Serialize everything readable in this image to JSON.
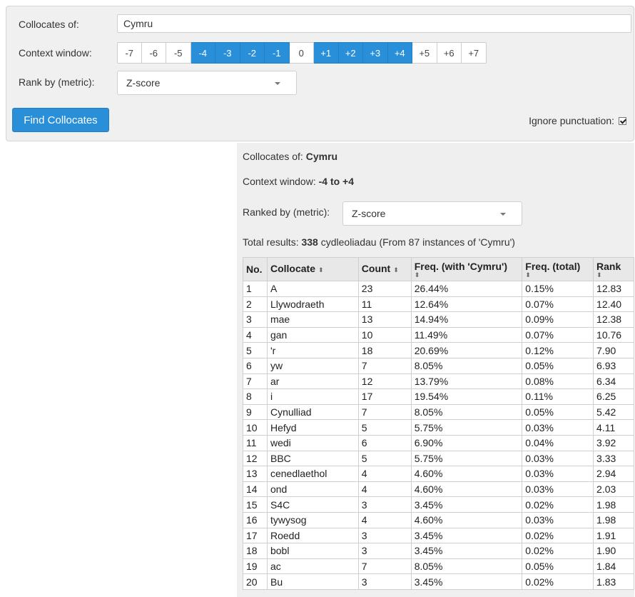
{
  "form": {
    "collocates_label": "Collocates of:",
    "collocates_value": "Cymru",
    "context_label": "Context window:",
    "context_cells": [
      {
        "label": "-7",
        "selected": false
      },
      {
        "label": "-6",
        "selected": false
      },
      {
        "label": "-5",
        "selected": false
      },
      {
        "label": "-4",
        "selected": true
      },
      {
        "label": "-3",
        "selected": true
      },
      {
        "label": "-2",
        "selected": true
      },
      {
        "label": "-1",
        "selected": true
      },
      {
        "label": "0",
        "selected": false
      },
      {
        "label": "+1",
        "selected": true
      },
      {
        "label": "+2",
        "selected": true
      },
      {
        "label": "+3",
        "selected": true
      },
      {
        "label": "+4",
        "selected": true
      },
      {
        "label": "+5",
        "selected": false
      },
      {
        "label": "+6",
        "selected": false
      },
      {
        "label": "+7",
        "selected": false
      }
    ],
    "rank_label": "Rank by (metric):",
    "rank_value": "Z-score",
    "find_button": "Find Collocates",
    "ignore_label": "Ignore punctuation:",
    "ignore_checked": true,
    "accent_color": "#2a8fd9"
  },
  "results": {
    "collocates_of_prefix": "Collocates of: ",
    "collocates_of_word": "Cymru",
    "context_prefix": "Context window: ",
    "context_range": "-4 to +4",
    "ranked_label": "Ranked by (metric):",
    "ranked_value": "Z-score",
    "total_prefix": "Total results: ",
    "total_count": "338",
    "total_suffix": " cydleoliadau (From 87 instances of 'Cymru')",
    "columns": [
      "No.",
      "Collocate",
      "Count",
      "Freq. (with 'Cymru')",
      "Freq. (total)",
      "Rank"
    ],
    "rows": [
      [
        "1",
        "A",
        "23",
        "26.44%",
        "0.15%",
        "12.83"
      ],
      [
        "2",
        "Llywodraeth",
        "11",
        "12.64%",
        "0.07%",
        "12.40"
      ],
      [
        "3",
        "mae",
        "13",
        "14.94%",
        "0.09%",
        "12.38"
      ],
      [
        "4",
        "gan",
        "10",
        "11.49%",
        "0.07%",
        "10.76"
      ],
      [
        "5",
        "'r",
        "18",
        "20.69%",
        "0.12%",
        "7.90"
      ],
      [
        "6",
        "yw",
        "7",
        "8.05%",
        "0.05%",
        "6.93"
      ],
      [
        "7",
        "ar",
        "12",
        "13.79%",
        "0.08%",
        "6.34"
      ],
      [
        "8",
        "i",
        "17",
        "19.54%",
        "0.11%",
        "6.25"
      ],
      [
        "9",
        "Cynulliad",
        "7",
        "8.05%",
        "0.05%",
        "5.42"
      ],
      [
        "10",
        "Hefyd",
        "5",
        "5.75%",
        "0.03%",
        "4.11"
      ],
      [
        "11",
        "wedi",
        "6",
        "6.90%",
        "0.04%",
        "3.92"
      ],
      [
        "12",
        "BBC",
        "5",
        "5.75%",
        "0.03%",
        "3.33"
      ],
      [
        "13",
        "cenedlaethol",
        "4",
        "4.60%",
        "0.03%",
        "2.94"
      ],
      [
        "14",
        "ond",
        "4",
        "4.60%",
        "0.03%",
        "2.03"
      ],
      [
        "15",
        "S4C",
        "3",
        "3.45%",
        "0.02%",
        "1.98"
      ],
      [
        "16",
        "tywysog",
        "4",
        "4.60%",
        "0.03%",
        "1.98"
      ],
      [
        "17",
        "Roedd",
        "3",
        "3.45%",
        "0.02%",
        "1.91"
      ],
      [
        "18",
        "bobl",
        "3",
        "3.45%",
        "0.02%",
        "1.90"
      ],
      [
        "19",
        "ac",
        "7",
        "8.05%",
        "0.05%",
        "1.84"
      ],
      [
        "20",
        "Bu",
        "3",
        "3.45%",
        "0.02%",
        "1.83"
      ]
    ]
  }
}
